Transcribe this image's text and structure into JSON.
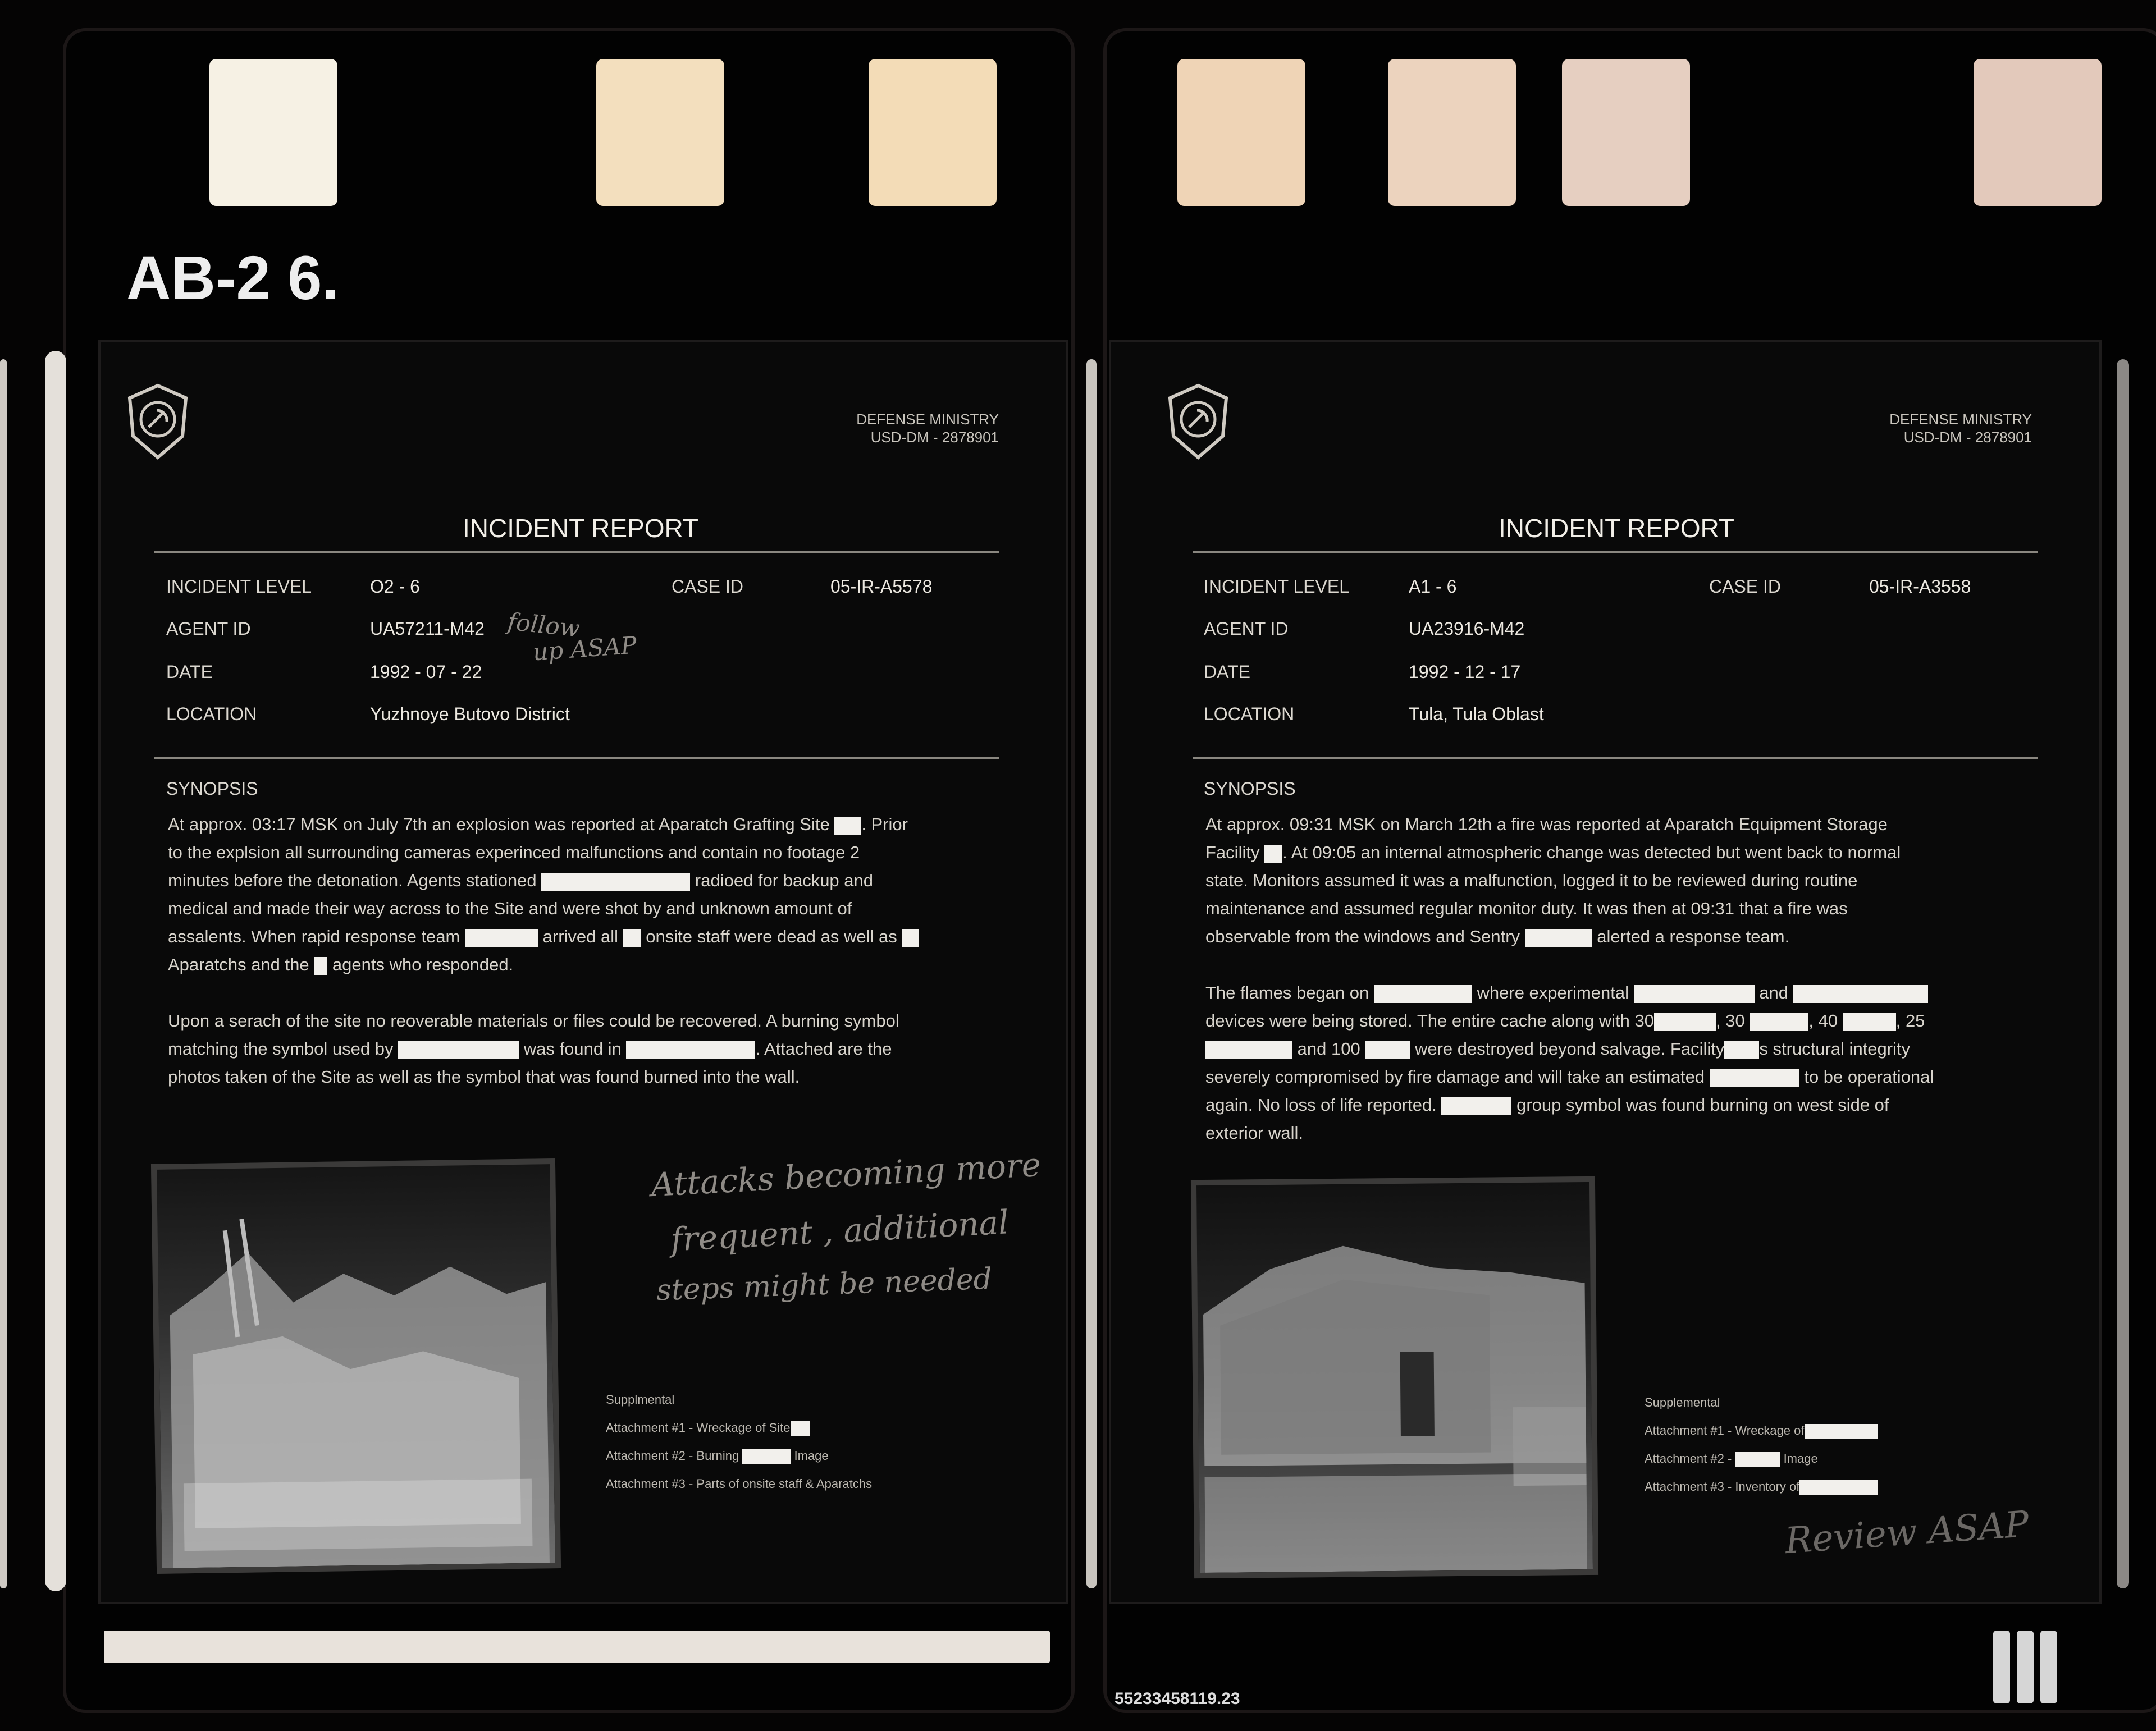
{
  "roll_label": "AB-2 6.",
  "footer_id": "55233458119.23",
  "colors": {
    "background": "#050404",
    "redaction": "#f2f0ec",
    "paper": "#090909",
    "text": "#e6e2da"
  },
  "left_report": {
    "ministry": "DEFENSE MINISTRY",
    "ministry_code": "USD-DM - 2878901",
    "title": "INCIDENT REPORT",
    "fields": {
      "incident_level_label": "INCIDENT LEVEL",
      "incident_level": "O2 - 6",
      "case_id_label": "CASE ID",
      "case_id": "05-IR-A5578",
      "agent_id_label": "AGENT ID",
      "agent_id": "UA57211-M42",
      "date_label": "DATE",
      "date": "1992 - 07 - 22",
      "location_label": "LOCATION",
      "location": "Yuzhnoye Butovo District"
    },
    "synopsis_label": "SYNOPSIS",
    "p1": [
      "At approx. 03:17 MSK on July 7th an explosion was reported at Aparatch Grafting Site",
      ". Prior",
      "to the explsion all surrounding cameras experinced malfunctions and contain no footage 2",
      "minutes before the detonation. Agents stationed",
      "radioed for backup and",
      "medical and made their way across to the Site and were shot by and unknown amount of",
      "assalents. When rapid response team",
      "arrived all",
      "onsite staff were dead as well as",
      "Aparatchs and the",
      "agents who responded."
    ],
    "p2": [
      "Upon a serach of the site no reoverable materials or files could be recovered. A burning symbol",
      "matching the symbol used by",
      "was found in",
      ". Attached are the",
      "photos taken of the Site as well as the symbol that was found burned into the wall."
    ],
    "supplemental": {
      "heading": "Supplmental",
      "a1": "Attachment #1 - Wreckage of Site",
      "a2a": "Attachment #2 - Burning",
      "a2b": "Image",
      "a3": "Attachment #3 - Parts of onsite staff & Aparatchs"
    },
    "handwriting": {
      "note1_line1": "follow",
      "note1_line2": "up ASAP",
      "note2_line1": "Attacks becoming more",
      "note2_line2": "frequent , additional",
      "note2_line3": "steps might be needed"
    }
  },
  "right_report": {
    "ministry": "DEFENSE MINISTRY",
    "ministry_code": "USD-DM - 2878901",
    "title": "INCIDENT REPORT",
    "fields": {
      "incident_level_label": "INCIDENT LEVEL",
      "incident_level": "A1 - 6",
      "case_id_label": "CASE ID",
      "case_id": "05-IR-A3558",
      "agent_id_label": "AGENT ID",
      "agent_id": "UA23916-M42",
      "date_label": "DATE",
      "date": "1992 - 12 - 17",
      "location_label": "LOCATION",
      "location": "Tula, Tula Oblast"
    },
    "synopsis_label": "SYNOPSIS",
    "p1": [
      "At approx. 09:31 MSK on March 12th a fire was reported at Aparatch Equipment Storage",
      "Facility",
      ". At 09:05 an internal atmospheric change was detected but went back to normal",
      "state. Monitors assumed it was a malfunction, logged it to be reviewed during routine",
      "maintenance and assumed regular monitor duty. It was then at 09:31 that a fire was",
      "observable from the windows and Sentry",
      "alerted a response team."
    ],
    "p2": [
      "The flames began on",
      "where experimental",
      "and",
      "devices were being stored. The entire cache along with 30",
      ", 30",
      ", 40",
      ", 25",
      "and 100",
      "were destroyed beyond salvage. Facility",
      "s structural integrity",
      "severely compromised by fire damage and will take an estimated",
      "to be operational",
      "again. No loss of life reported.",
      "group symbol was found burning on west side of",
      "exterior wall."
    ],
    "supplemental": {
      "heading": "Supplemental",
      "a1": "Attachment #1 - Wreckage of",
      "a2a": "Attachment #2 -",
      "a2b": "Image",
      "a3": "Attachment #3 - Inventory of"
    },
    "handwriting": {
      "note1": "Review ASAP"
    }
  }
}
